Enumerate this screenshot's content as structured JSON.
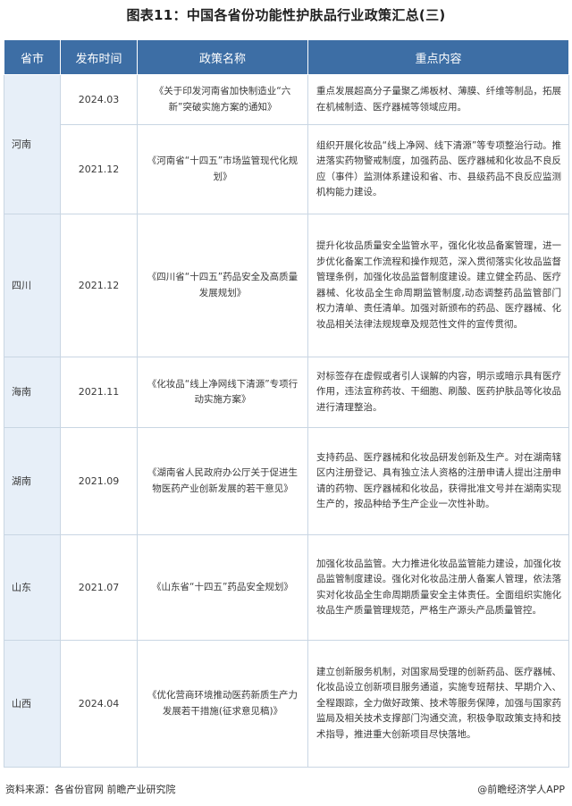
{
  "title": "图表11：中国各省份功能性护肤品行业政策汇总(三)",
  "headers": [
    "省市",
    "发布时间",
    "政策名称",
    "重点内容"
  ],
  "rows": [
    {
      "prov": "河南",
      "date": "2024.03",
      "name": "《关于印发河南省加快制造业“六新”突破实施方案的通知》",
      "content": "重点发展超高分子量聚乙烯板材、薄膜、纤维等制品，拓展在机械制造、医疗器械等领域应用。"
    },
    {
      "prov": "",
      "date": "2021.12",
      "name": "《河南省“十四五”市场监管现代化规划》",
      "content": "组织开展化妆品“线上净网、线下清源”等专项整治行动。推进落实药物警戒制度，加强药品、医疗器械和化妆品不良反应（事件）监测体系建设和省、市、县级药品不良反应监测机构能力建设。"
    },
    {
      "prov": "四川",
      "date": "2021.12",
      "name": "《四川省“十四五”药品安全及高质量发展规划》",
      "content": "提升化妆品质量安全监管水平，强化化妆品备案管理，进一步优化备案工作流程和操作规范，深入贯彻落实化妆品监督管理条例，加强化妆品监督制度建设。建立健全药品、医疗器械、化妆品全生命周期监管制度,动态调整药品监管部门权力清单、责任清单。加强对新颁布的药品、医疗器械、化妆品相关法律法规规章及规范性文件的宣传贯彻。"
    },
    {
      "prov": "海南",
      "date": "2021.11",
      "name": "《化妆品“线上净网线下清源”专项行动实施方案》",
      "content": "对标签存在虚假或者引人误解的内容，明示或暗示具有医疗作用，违法宣称药妆、干细胞、刷酸、医药护肤品等化妆品进行清理整治。"
    },
    {
      "prov": "湖南",
      "date": "2021.09",
      "name": "《湖南省人民政府办公厅关于促进生物医药产业创新发展的若干意见》",
      "content": "支持药品、医疗器械和化妆品研发创新及生产。对在湖南辖区内注册登记、具有独立法人资格的注册申请人提出注册申请的药物、医疗器械和化妆品，获得批准文号并在湖南实现生产的，按品种给予生产企业一次性补助。"
    },
    {
      "prov": "山东",
      "date": "2021.07",
      "name": "《山东省“十四五”药品安全规划》",
      "content": "加强化妆品监管。大力推进化妆品监管能力建设，加强化妆品监管制度建设。强化对化妆品注册人备案人管理，依法落实对化妆品全生命周期质量安全主体责任。全面组织实施化妆品生产质量管理规范，严格生产源头产品质量管控。"
    },
    {
      "prov": "山西",
      "date": "2024.04",
      "name": "《优化营商环境推动医药新质生产力发展若干措施(征求意见稿)》",
      "content": "建立创新服务机制，对国家局受理的创新药品、医疗器械、化妆品设立创新项目服务通道，实施专班帮扶、早期介入、全程跟踪，全力做好政策、技术等服务保障，加强与国家药监局及相关技术支撑部门沟通交流，积极争取政策支持和技术指导，推进重大创新项目尽快落地。"
    }
  ],
  "footer": {
    "source": "资料来源：各省份官网 前瞻产业研究院",
    "brand": "@前瞻经济学人APP"
  },
  "colors": {
    "header_bg": "#3d6ea5",
    "province_bg": "#e7eff8",
    "border": "#c9d6e3"
  }
}
